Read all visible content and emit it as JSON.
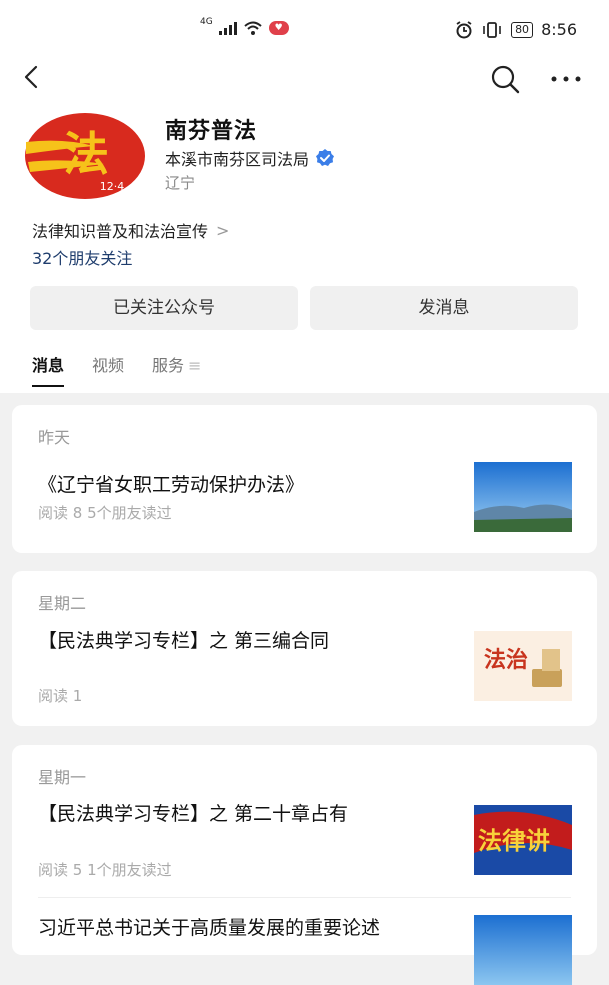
{
  "status_bar": {
    "network": "4G",
    "time": "8:56",
    "battery": "80"
  },
  "account": {
    "logo_caption": "12·4",
    "name": "南芬普法",
    "organization": "本溪市南芬区司法局",
    "region": "辽宁",
    "intro": "法律知识普及和法治宣传",
    "friends_following": "32个朋友关注"
  },
  "actions": {
    "followed_label": "已关注公众号",
    "message_label": "发消息"
  },
  "tabs": [
    "消息",
    "视频",
    "服务"
  ],
  "feed": [
    {
      "date": "昨天",
      "articles": [
        {
          "title": "《辽宁省女职工劳动保护办法》",
          "meta": "阅读 8   5个朋友读过"
        }
      ]
    },
    {
      "date": "星期二",
      "articles": [
        {
          "title": "【民法典学习专栏】之      第三编合同",
          "meta": "阅读 1"
        }
      ]
    },
    {
      "date": "星期一",
      "articles": [
        {
          "title": "【民法典学习专栏】之 第二十章占有",
          "meta": "阅读 5   1个朋友读过"
        },
        {
          "title": "习近平总书记关于高质量发展的重要论述",
          "meta": ""
        }
      ]
    }
  ],
  "thumb_texts": {
    "fazhi": "法治",
    "falv": "法律讲"
  },
  "colors": {
    "verified_blue": "#3b7ee8",
    "logo_red": "#d82a1e",
    "logo_yellow": "#f6c21a",
    "friends_link": "#1f3d6d"
  }
}
